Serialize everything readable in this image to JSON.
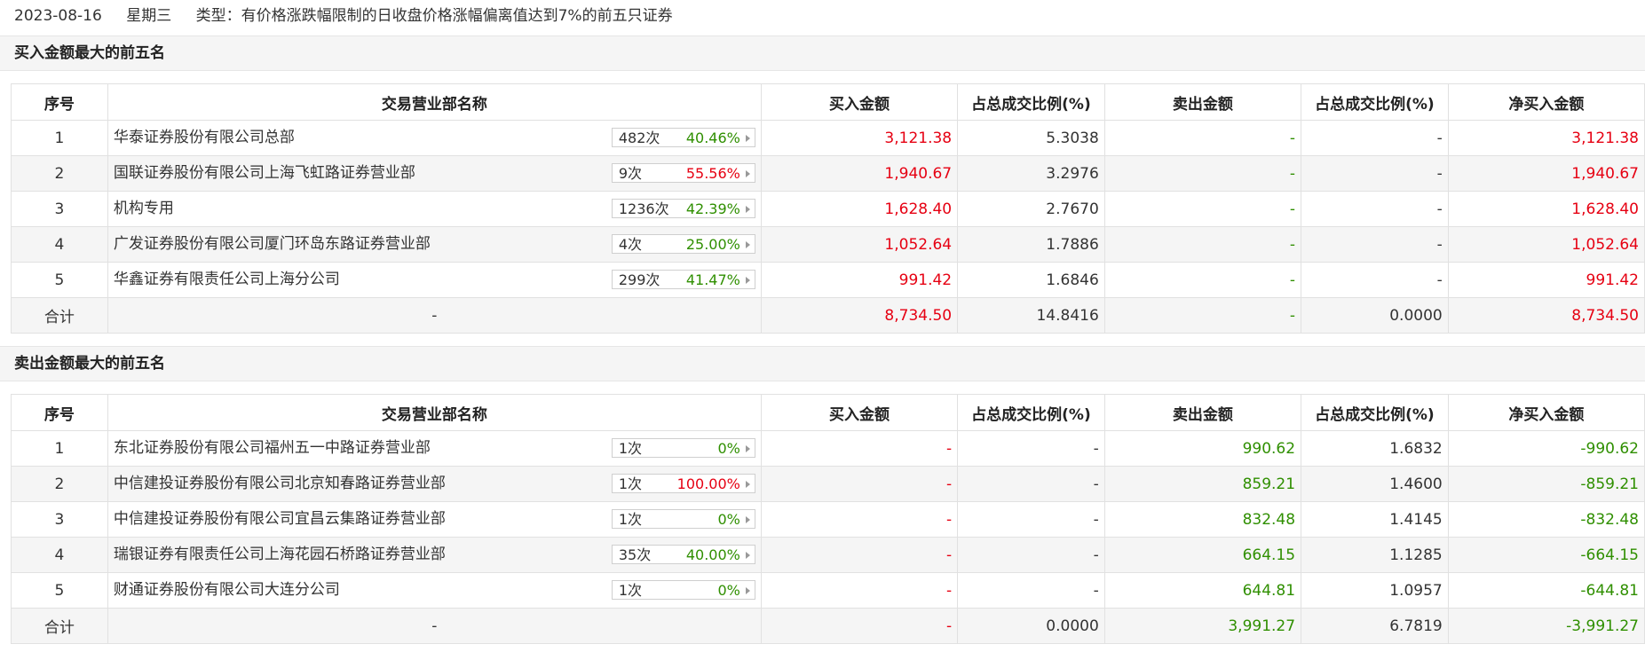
{
  "header": {
    "date": "2023-08-16",
    "weekday": "星期三",
    "type_text": "类型：有价格涨跌幅限制的日收盘价格涨幅偏离值达到7%的前五只证券"
  },
  "columns": {
    "idx": "序号",
    "name": "交易营业部名称",
    "buy": "买入金额",
    "buy_ratio": "占总成交比例(%)",
    "sell": "卖出金额",
    "sell_ratio": "占总成交比例(%)",
    "net": "净买入金额"
  },
  "buy_section": {
    "title": "买入金额最大的前五名",
    "rows": [
      {
        "idx": "1",
        "name": "华泰证券股份有限公司总部",
        "count": "482次",
        "rate": "40.46%",
        "rate_color": "green",
        "buy": "3,121.38",
        "buy_ratio": "5.3038",
        "sell": "-",
        "sell_ratio": "-",
        "net": "3,121.38"
      },
      {
        "idx": "2",
        "name": "国联证券股份有限公司上海飞虹路证券营业部",
        "count": "9次",
        "rate": "55.56%",
        "rate_color": "red",
        "buy": "1,940.67",
        "buy_ratio": "3.2976",
        "sell": "-",
        "sell_ratio": "-",
        "net": "1,940.67"
      },
      {
        "idx": "3",
        "name": "机构专用",
        "count": "1236次",
        "rate": "42.39%",
        "rate_color": "green",
        "buy": "1,628.40",
        "buy_ratio": "2.7670",
        "sell": "-",
        "sell_ratio": "-",
        "net": "1,628.40"
      },
      {
        "idx": "4",
        "name": "广发证券股份有限公司厦门环岛东路证券营业部",
        "count": "4次",
        "rate": "25.00%",
        "rate_color": "green",
        "buy": "1,052.64",
        "buy_ratio": "1.7886",
        "sell": "-",
        "sell_ratio": "-",
        "net": "1,052.64"
      },
      {
        "idx": "5",
        "name": "华鑫证券有限责任公司上海分公司",
        "count": "299次",
        "rate": "41.47%",
        "rate_color": "green",
        "buy": "991.42",
        "buy_ratio": "1.6846",
        "sell": "-",
        "sell_ratio": "-",
        "net": "991.42"
      }
    ],
    "total": {
      "label": "合计",
      "name": "-",
      "buy": "8,734.50",
      "buy_ratio": "14.8416",
      "sell": "-",
      "sell_ratio": "0.0000",
      "net": "8,734.50"
    }
  },
  "sell_section": {
    "title": "卖出金额最大的前五名",
    "rows": [
      {
        "idx": "1",
        "name": "东北证券股份有限公司福州五一中路证券营业部",
        "count": "1次",
        "rate": "0%",
        "rate_color": "green",
        "buy": "-",
        "buy_ratio": "-",
        "sell": "990.62",
        "sell_ratio": "1.6832",
        "net": "-990.62"
      },
      {
        "idx": "2",
        "name": "中信建投证券股份有限公司北京知春路证券营业部",
        "count": "1次",
        "rate": "100.00%",
        "rate_color": "red",
        "buy": "-",
        "buy_ratio": "-",
        "sell": "859.21",
        "sell_ratio": "1.4600",
        "net": "-859.21"
      },
      {
        "idx": "3",
        "name": "中信建投证券股份有限公司宜昌云集路证券营业部",
        "count": "1次",
        "rate": "0%",
        "rate_color": "green",
        "buy": "-",
        "buy_ratio": "-",
        "sell": "832.48",
        "sell_ratio": "1.4145",
        "net": "-832.48"
      },
      {
        "idx": "4",
        "name": "瑞银证券有限责任公司上海花园石桥路证券营业部",
        "count": "35次",
        "rate": "40.00%",
        "rate_color": "green",
        "buy": "-",
        "buy_ratio": "-",
        "sell": "664.15",
        "sell_ratio": "1.1285",
        "net": "-664.15"
      },
      {
        "idx": "5",
        "name": "财通证券股份有限公司大连分公司",
        "count": "1次",
        "rate": "0%",
        "rate_color": "green",
        "buy": "-",
        "buy_ratio": "-",
        "sell": "644.81",
        "sell_ratio": "1.0957",
        "net": "-644.81"
      }
    ],
    "total": {
      "label": "合计",
      "name": "-",
      "buy": "-",
      "buy_ratio": "0.0000",
      "sell": "3,991.27",
      "sell_ratio": "6.7819",
      "net": "-3,991.27"
    }
  },
  "colors": {
    "red": "#e60012",
    "green": "#2f8f00"
  }
}
